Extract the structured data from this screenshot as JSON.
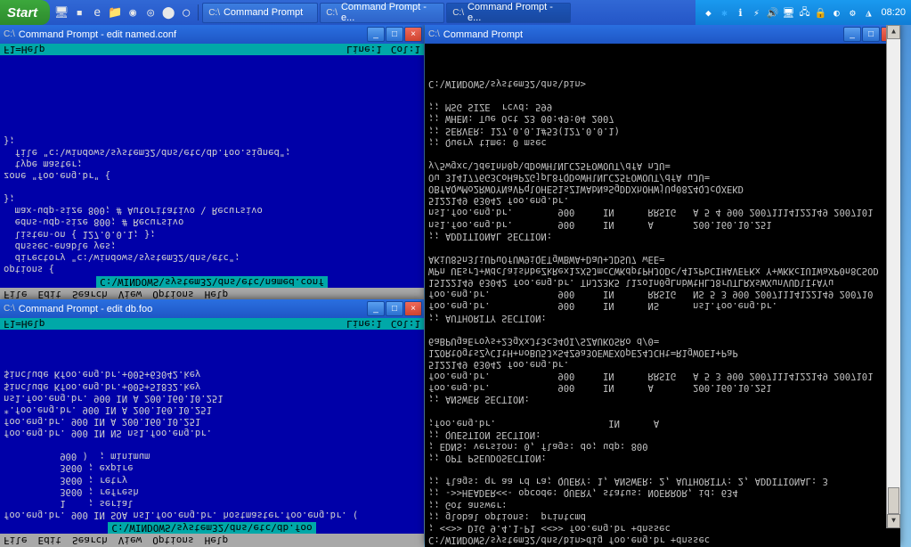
{
  "taskbar": {
    "start_label": "Start",
    "clock": "08:20",
    "tasks": [
      {
        "label": "Command Prompt"
      },
      {
        "label": "Command Prompt - e..."
      },
      {
        "label": "Command Prompt - e..."
      }
    ]
  },
  "window_named": {
    "title": "Command Prompt - edit named.conf",
    "menu": [
      "File",
      "Edit",
      "Search",
      "View",
      "Options",
      "Help"
    ],
    "path": "C:\\WINDOWS\\system32\\dns\\etc\\named.conf",
    "content": "options {\n  directory \"c:\\windows\\system32\\dns\\etc\";\n  dnssec-enable yes;\n  listen-on { 127.0.0.1; };\n  edns-udp-size 800; # Recursivo\n  max-udp-size 800; # Autoritativo \\ Recursivo\n};\n\nzone \"foo.eng.br\" {\n  type master;\n  file \"c:\\windows\\system32\\dns\\etc\\db.foo.signed\";\n};\n",
    "status_left": "F1=Help",
    "status_line": "Line:1",
    "status_col": "Col:1"
  },
  "window_dbfoo": {
    "title": "Command Prompt - edit db.foo",
    "menu": [
      "File",
      "Edit",
      "Search",
      "View",
      "Options",
      "Help"
    ],
    "path": "C:\\WINDOWS\\system32\\dns\\etc\\db.foo",
    "content": "foo.eng.br. 900 IN SOA ns1.foo.eng.br. hostmaster.foo.eng.br. (\n          1    ; serial\n          3600 ; refresh\n          3600 ; retry\n          3600 ; expire\n          900 )  ; minimum\n\nfoo.eng.br. 900 IN NS ns1.foo.eng.br.\nfoo.eng.br. 900 IN A 200.160.10.251\n*.foo.eng.br. 900 IN A 200.160.10.251\nns1.foo.eng.br. 900 IN A 200.160.10.251\n$include Kfoo.eng.br.+005+51832.key\n$include Kfoo.eng.br.+005+63042.key",
    "status_left": "F1=Help",
    "status_line": "Line:1",
    "status_col": "Col:1"
  },
  "window_dig": {
    "title": "Command Prompt",
    "prompt": "C:\\WINDOWS\\system32\\dns\\bin>",
    "cmd": "dig foo.eng.br +dnssec",
    "output": "; <<>> DiG 9.4.1-P1 <<>> foo.eng.br +dnssec\n;; global options:  printcmd\n;; Got answer:\n;; ->>HEADER<<- opcode: QUERY, status: NOERROR, id: 634\n;; flags: qr aa rd ra; QUERY: 1, ANSWER: 2, AUTHORITY: 2, ADDITIONAL: 3\n\n;; OPT PSEUDOSECTION:\n; EDNS: version: 0, flags: do; udp: 800\n;; QUESTION SECTION:\n;foo.eng.br.                    IN      A\n\n;; ANSWER SECTION:\nfoo.eng.br.            900     IN      A       200.160.10.251\nfoo.eng.br.            900     IN      RRSIG   A 5 3 900 20071114122149 2007101\n5122149 63042 foo.eng.br. 1ZORtOgtsZyC1tH+noBU5JxS4Z9a3OEWEXOpE24JCHt=R1gWOE1+PaP\n6aBPUgaEroys+23gXxJt3c34QI/SZAUKOSRo d/0=\n\n;; AUTHORITY SECTION:\nfoo.eng.br.            900     IN      NS      ns1.foo.eng.br.\nfoo.eng.br.            900     IN      RRSIG   NS 5 3 900 20071114122149 200710\n15122149 63042 foo.eng.br. ThJ23K5 l1zo1n0gLnbWtHLJ8rUTLRXsWXunVUDlItAYu\nWPn UEsrJ+WdclaishbeZkRex1zX5JmcCWKdptPHJODc\\41zPbCIHAVEFKx Y+WKKcIUIWaXP0n8CSOD\nAKiU85n3liUPuOfUW9iQETgWBWA+DaU+JDSU7 wEE=\n\n;; ADDITIONAL SECTION:\nns1.foo.eng.br.        900     IN      A       200.160.10.251\nns1.foo.eng.br.        900     IN      RRSIG   A 5 4 900 20071114122149 2007101\n5122149 63042 foo.eng.br. OBfAQwMo2RWOYNaVPqlOHES1sZ1WAbNaSgDDXhOHWjUq08Z4QJcQXEKD\nOu 3141776G3CoHaPZGjpL8fQDoWHlNLC25FOWOUT/dfA uJU=\ny/5wgxc\\JdeInh0p\\dDoWHlNLC25FOWOUT/dfA nJU=\n\n;; Query time: 0 msec\n;; SERVER: 127.0.0.1#53(127.0.0.1)\n;; WHEN: Tue Oct 23 00:49:04 2007\n;; MSG SIZE  rcvd: 599\n\nC:\\WINDOWS\\system32\\dns\\bin>"
  }
}
